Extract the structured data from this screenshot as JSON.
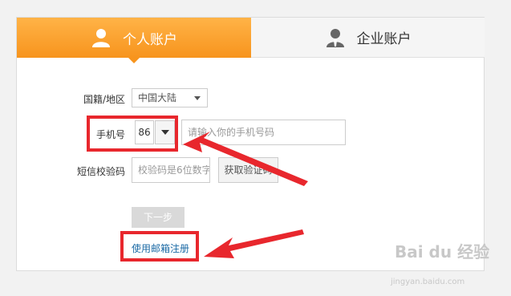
{
  "tabs": {
    "personal_label": "个人账户",
    "business_label": "企业账户"
  },
  "form": {
    "region_label": "国籍/地区",
    "region_value": "中国大陆",
    "phone_label": "手机号",
    "country_code": "86",
    "phone_placeholder": "请输入你的手机号码",
    "sms_label": "短信校验码",
    "sms_placeholder": "校验码是6位数字",
    "get_code_label": "获取验证码",
    "next_label": "下一步",
    "email_link_label": "使用邮箱注册"
  },
  "watermark": {
    "brand": "Bai du 经验",
    "url": "jingyan.baidu.com"
  },
  "colors": {
    "accent": "#f7941d",
    "highlight": "#e8272d",
    "link": "#1b6aa5"
  }
}
